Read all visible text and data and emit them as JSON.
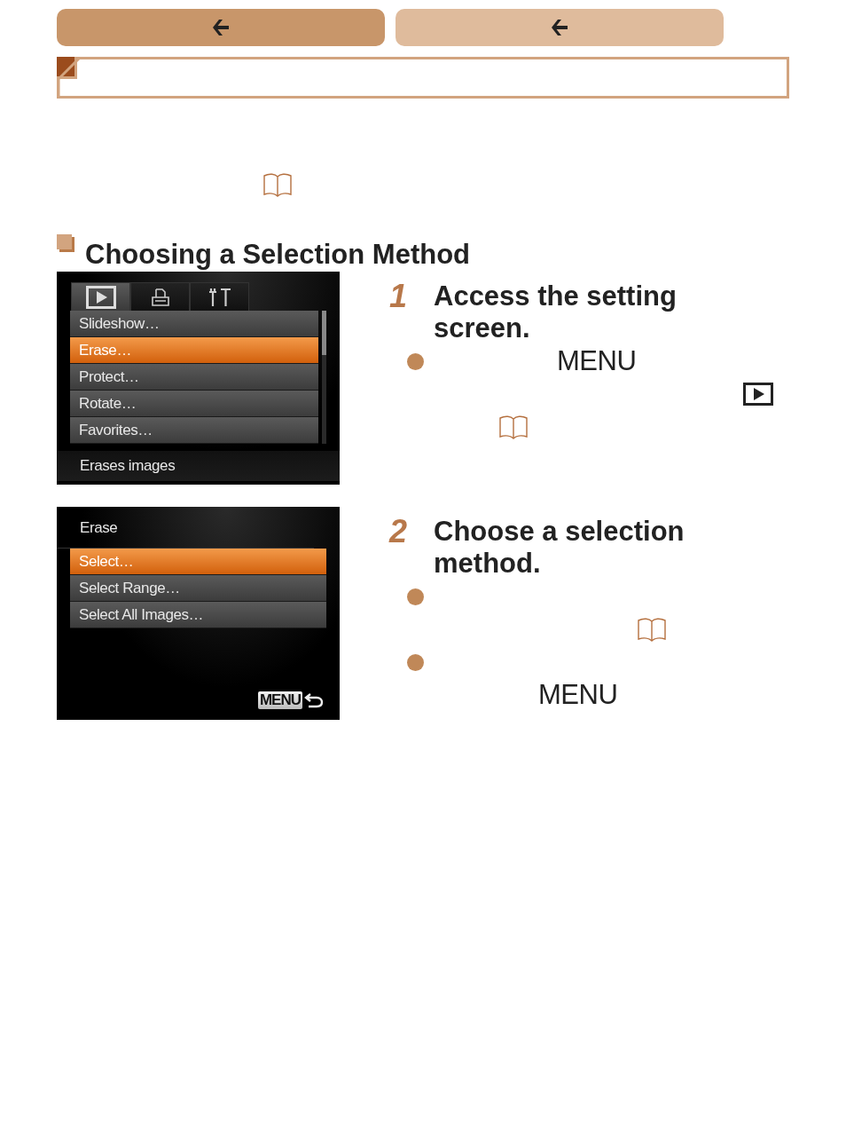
{
  "nav_buttons": [
    {
      "disabled": false
    },
    {
      "disabled": true
    }
  ],
  "section": {
    "heading": "Choosing a Selection Method"
  },
  "steps": [
    {
      "number": "1",
      "title": "Access the setting screen.",
      "screen": {
        "kind": "menu",
        "tabs": [
          {
            "kind": "play",
            "selected": true
          },
          {
            "kind": "print",
            "selected": false
          },
          {
            "kind": "tools",
            "selected": false
          }
        ],
        "items": [
          {
            "label": "Slideshow…",
            "selected": false
          },
          {
            "label": "Erase…",
            "selected": true
          },
          {
            "label": "Protect…",
            "selected": false
          },
          {
            "label": "Rotate…",
            "selected": false
          },
          {
            "label": "Favorites…",
            "selected": false
          }
        ],
        "hint": "Erases images"
      },
      "bullets": [
        {
          "parts": [
            {
              "kind": "key",
              "text": "MENU"
            },
            {
              "kind": "play"
            },
            {
              "kind": "book"
            }
          ]
        }
      ]
    },
    {
      "number": "2",
      "title": "Choose a selection method.",
      "screen": {
        "kind": "submenu",
        "title": "Erase",
        "items": [
          {
            "label": "Select…",
            "selected": true
          },
          {
            "label": "Select Range…",
            "selected": false
          },
          {
            "label": "Select All Images…",
            "selected": false
          }
        ],
        "back_key": "MENU"
      },
      "bullets": [
        {
          "parts": [
            {
              "kind": "book"
            }
          ]
        },
        {
          "parts": [
            {
              "kind": "key",
              "text": "MENU"
            }
          ]
        }
      ]
    }
  ]
}
